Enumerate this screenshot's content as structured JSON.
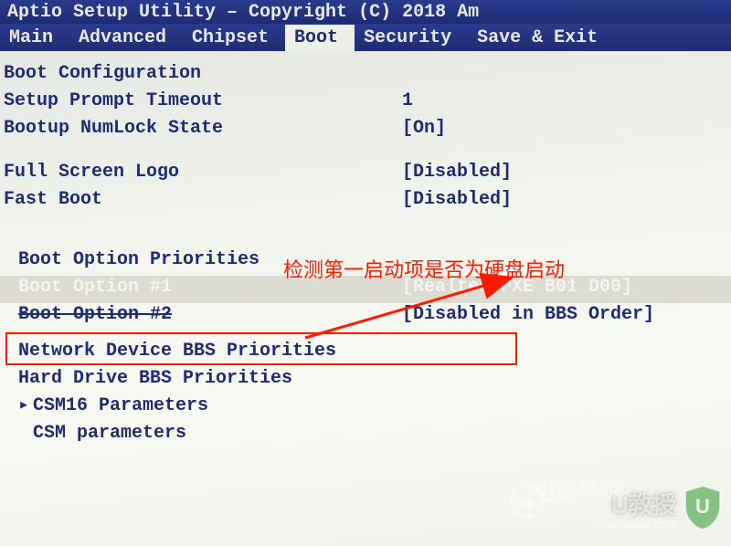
{
  "titlebar": "Aptio Setup Utility – Copyright (C) 2018 Am",
  "menu": {
    "items": [
      "Main",
      "Advanced",
      "Chipset",
      "Boot",
      "Security",
      "Save & Exit"
    ],
    "active_index": 3
  },
  "sections": {
    "boot_config_header": "Boot Configuration",
    "setup_prompt_timeout": {
      "label": "Setup Prompt Timeout",
      "value": "1"
    },
    "bootup_numlock": {
      "label": "Bootup NumLock State",
      "value": "[On]"
    },
    "full_screen_logo": {
      "label": "Full Screen Logo",
      "value": "[Disabled]"
    },
    "fast_boot": {
      "label": "Fast Boot",
      "value": "[Disabled]"
    },
    "boot_option_priorities_header": "Boot Option Priorities",
    "boot_option_1": {
      "label": "Boot Option #1",
      "value": "[Realtek PXE B01 D00]"
    },
    "boot_option_2": {
      "label": "Boot Option #2",
      "value": "[Disabled in BBS Order]"
    },
    "network_bbs": {
      "label": "Network Device BBS Priorities"
    },
    "harddrive_bbs": {
      "label": "Hard Drive BBS Priorities"
    },
    "csm16": {
      "label": "CSM16 Parameters"
    },
    "csm": {
      "label": "CSM parameters"
    }
  },
  "annotation": {
    "text": "检测第一启动项是否为硬盘启动"
  },
  "watermarks": {
    "brand1": "U教授",
    "brand1_sub": "UJIAOSHOU.COM",
    "brand2": "电脑系统"
  }
}
